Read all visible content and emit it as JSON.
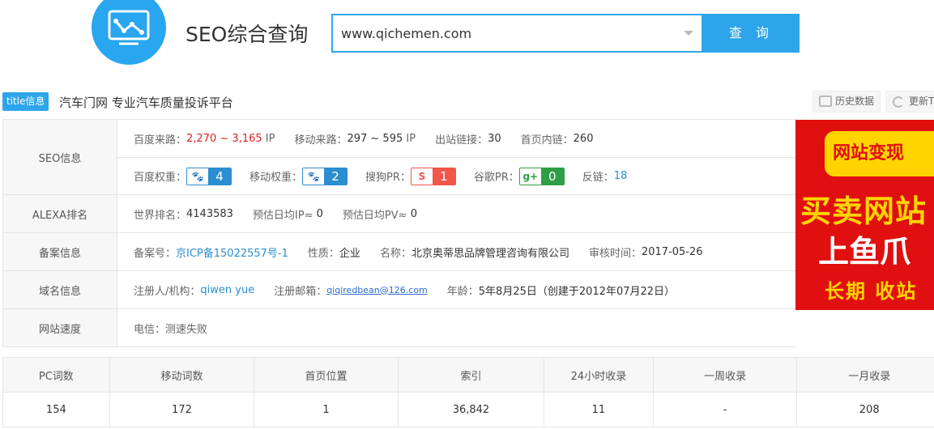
{
  "header": {
    "title": "SEO综合查询",
    "search_value": "www.qichemen.com",
    "search_button": "查 询"
  },
  "title_row": {
    "badge": "title信息",
    "text": "汽车门网 专业汽车质量投诉平台",
    "history_label": "历史数据",
    "update_label": "更新T"
  },
  "seo": {
    "label": "SEO信息",
    "baidu_traffic_label": "百度来路：",
    "baidu_traffic_value": "2,270 ~ 3,165",
    "ip_unit": "IP",
    "mobile_traffic_label": "移动来路：",
    "mobile_traffic_value": "297 ~ 595",
    "outbound_label": "出站链接：",
    "outbound_value": "30",
    "inbound_label": "首页内链：",
    "inbound_value": "260",
    "baidu_weight_label": "百度权重：",
    "baidu_weight_value": "4",
    "mobile_weight_label": "移动权重：",
    "mobile_weight_value": "2",
    "sogou_label": "搜狗PR：",
    "sogou_value": "1",
    "google_label": "谷歌PR：",
    "google_value": "0",
    "backlinks_label": "反链：",
    "backlinks_value": "18"
  },
  "alexa": {
    "label": "ALEXA排名",
    "world_rank_label": "世界排名：",
    "world_rank_value": "4143583",
    "ip_est_label": "预估日均IP≈",
    "ip_est_value": "0",
    "pv_est_label": "预估日均PV≈",
    "pv_est_value": "0"
  },
  "icp": {
    "label": "备案信息",
    "number_label": "备案号：",
    "number_value": "京ICP备15022557号-1",
    "nature_label": "性质：",
    "nature_value": "企业",
    "name_label": "名称：",
    "name_value": "北京奥蒂思品牌管理咨询有限公司",
    "audit_label": "审核时间：",
    "audit_value": "2017-05-26"
  },
  "domain": {
    "label": "域名信息",
    "registrant_label": "注册人/机构：",
    "registrant_value": "qiwen yue",
    "email_label": "注册邮箱：",
    "email_value": "qiqiredbean@126.com",
    "age_label": "年龄：",
    "age_value": "5年8月25日（创建于2012年07月22日）"
  },
  "speed": {
    "label": "网站速度",
    "value": "电信：测速失败"
  },
  "ad": {
    "line1": "网站变现",
    "line2": "买卖网站",
    "line3": "上鱼爪",
    "line4": "长期 收站"
  },
  "stats": {
    "headers": [
      "PC词数",
      "移动词数",
      "首页位置",
      "索引",
      "24小时收录",
      "一周收录",
      "一月收录"
    ],
    "values": [
      "154",
      "172",
      "1",
      "36,842",
      "11",
      "-",
      "208"
    ]
  },
  "colors": {
    "accent": "#2da5ea",
    "red": "#e12020",
    "sogou": "#f0564a",
    "google": "#2e9e48"
  }
}
